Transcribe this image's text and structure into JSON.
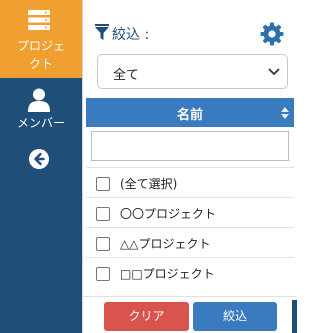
{
  "sidebar": {
    "project_label_line1": "プロジェ",
    "project_label_line2": "クト",
    "member_label": "メンバー"
  },
  "filter": {
    "label": "絞込 :",
    "select_value": "全て"
  },
  "table": {
    "column_header": "名前",
    "search_value": "",
    "items": [
      {
        "label": "(全て選択)"
      },
      {
        "label": "〇〇プロジェクト"
      },
      {
        "label": "△△プロジェクト"
      },
      {
        "label": "□□プロジェクト"
      }
    ]
  },
  "footer": {
    "clear_label": "クリア",
    "apply_label": "絞込"
  },
  "colors": {
    "sidebar": "#1f4e79",
    "active_nav": "#f0a030",
    "accent": "#3a7abf",
    "danger": "#d9534f"
  }
}
